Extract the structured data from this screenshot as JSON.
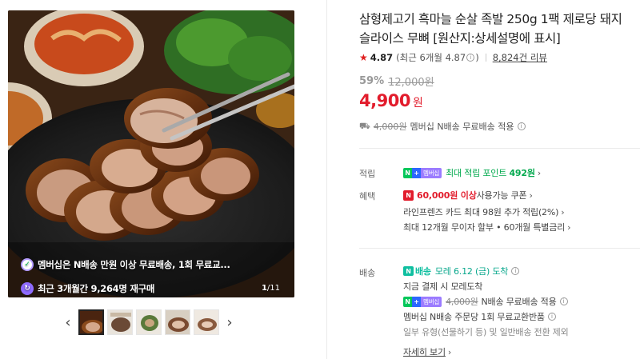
{
  "gallery": {
    "promo_line_1": "멤버십은 N배송 만원 이상 무료배송, 1회 무료교...",
    "promo_line_2": "최근 3개월간 9,264명 재구매",
    "counter_current": "1",
    "counter_total": "/11",
    "prev_arrow": "‹",
    "next_arrow": "›",
    "thumbnails": 5
  },
  "product": {
    "title": "삼형제고기 흑마늘 순살 족발 250g 1팩 제로당 돼지 슬라이스 무뼈 [원산지:상세설명에 표시]",
    "rating": "4.87",
    "rating_recent": "(최근 6개월 4.87",
    "rating_recent_close": ")",
    "reviews": "8,824건 리뷰",
    "discount_pct": "59%",
    "original_price": "12,000원",
    "price": "4,900",
    "price_unit": "원",
    "shipping_fee_strike": "4,000원",
    "shipping_summary": "멤버십 N배송 무료배송 적용"
  },
  "benefits": {
    "points_label": "적립",
    "points_prefix": "최대 적립 포인트 ",
    "points_value": "492원",
    "benefit_label": "혜택",
    "coupon_amount": "60,000원 이상",
    "coupon_suffix": " 사용가능 쿠폰",
    "card_points": "라인프렌즈 카드 최대 98원 추가 적립(2%)",
    "installment": "최대 12개월 무이자 할부 • 60개월 특별금리"
  },
  "delivery": {
    "label": "배송",
    "n_delivery": "배송",
    "arrival": "모레 6.12 (금) 도착",
    "order_note": "지금 결제 시 모레도착",
    "fee_strike": "4,000원",
    "fee_text": "N배송 무료배송 적용",
    "return_note": "멤버십 N배송 주문당 1회 무료교환반품",
    "exclusion_note": "일부 유형(선물하기 등) 및 일반배송 전환 제외",
    "more": "자세히 보기"
  },
  "badges": {
    "nplus_n": "N",
    "nplus_plus": "+",
    "nplus_member": "멤버십",
    "npay": "N",
    "ndeliv_icon": "N",
    "icon_truck": "truck-icon",
    "icon_info": "info-icon",
    "icon_star": "star-icon"
  },
  "colors": {
    "price_red": "#e21c2c",
    "green": "#03a94e",
    "teal": "#0aa88d",
    "membership_purple": "#9b7bff"
  }
}
